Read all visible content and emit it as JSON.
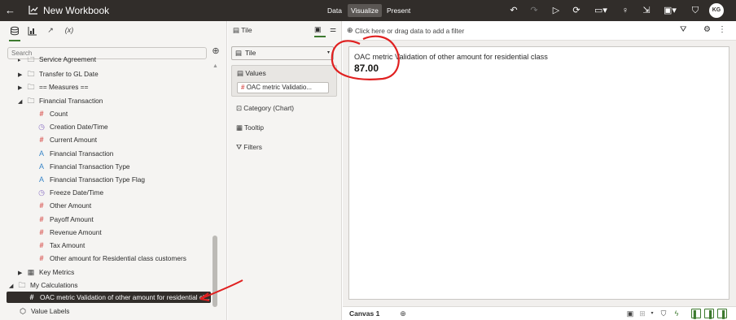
{
  "topbar": {
    "title": "New Workbook",
    "modes": [
      "Data",
      "Visualize",
      "Present"
    ],
    "active_mode": "Visualize",
    "avatar_initials": "KG"
  },
  "left_panel": {
    "tabs": [
      "data-icon",
      "visualizations-icon",
      "analytics-icon",
      "calculations-icon"
    ],
    "calc_tab_label": "(x)",
    "search_placeholder": "Search",
    "tree": {
      "truncated_top": "Service Agreement",
      "transfer": "Transfer to GL Date",
      "measures": "== Measures ==",
      "financial_transaction": "Financial Transaction",
      "fields": [
        {
          "type": "hash",
          "label": "Count"
        },
        {
          "type": "clock",
          "label": "Creation Date/Time"
        },
        {
          "type": "hash",
          "label": "Current Amount"
        },
        {
          "type": "letter",
          "label": "Financial Transaction"
        },
        {
          "type": "letter",
          "label": "Financial Transaction Type"
        },
        {
          "type": "letter",
          "label": "Financial Transaction Type Flag"
        },
        {
          "type": "clock",
          "label": "Freeze Date/Time"
        },
        {
          "type": "hash",
          "label": "Other Amount"
        },
        {
          "type": "hash",
          "label": "Payoff Amount"
        },
        {
          "type": "hash",
          "label": "Revenue Amount"
        },
        {
          "type": "hash",
          "label": "Tax Amount"
        },
        {
          "type": "hash",
          "label": "Other amount for Residential class customers"
        }
      ],
      "key_metrics": "Key Metrics",
      "my_calculations": "My Calculations",
      "selected_calc": "OAC metric Validation of other amount for residential cl...",
      "value_labels": "Value Labels"
    }
  },
  "mid_panel": {
    "header": "Tile",
    "viz_type": "Tile",
    "values_label": "Values",
    "values_chip": "OAC metric Validatio...",
    "category_label": "Category (Chart)",
    "tooltip_label": "Tooltip",
    "filters_label": "Filters"
  },
  "filter_bar": {
    "placeholder": "Click here or drag data to add a filter"
  },
  "tile": {
    "title": "OAC metric Validation of other amount for residential class",
    "value": "87.00"
  },
  "bottom_bar": {
    "canvas_tab": "Canvas 1"
  },
  "colors": {
    "topbar_bg": "#312d2a",
    "accent_green": "#3d7a2f",
    "annotation_red": "#e02020",
    "measure_icon": "#d9534f",
    "date_icon": "#8a6fc4",
    "text_icon": "#3a86c8"
  }
}
